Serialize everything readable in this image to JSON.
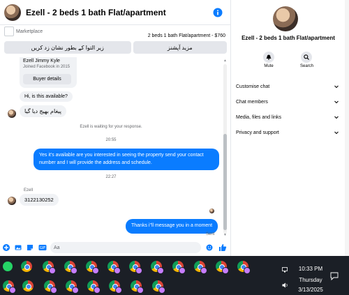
{
  "chat": {
    "title": "Ezell - 2 beds 1 bath Flat/apartment",
    "marketplace_label": "Marketplace",
    "listing_line": "2 beds 1 bath Flat/apartment - $760",
    "btn_more_options": "مزید آپشنز",
    "btn_mark_pending": "زیر التوا کے بطور نشان زد کریں"
  },
  "profile_card": {
    "name": "Ezell Jimmy Kyle",
    "joined": "Joined Facebook in 2015",
    "buyer_details": "Buyer details"
  },
  "messages": {
    "m1": "Hi, is this available?",
    "m2": "پیغام بھیج دیا گیا",
    "waiting": "Ezell is waiting for your response.",
    "time1": "20:55",
    "reply1": "Yes it's available are you interested in seeing the property send your contact number and I will provide the address and schedule.",
    "time2": "22:27",
    "sender": "Ezell",
    "m3": "3122130252",
    "reply2": "Thanks i\"ll message you in a moment",
    "sent": "Sent"
  },
  "composer": {
    "placeholder": "Aa"
  },
  "info": {
    "title": "Ezell - 2 beds 1 bath Flat/apartment",
    "mute": "Mute",
    "search": "Search",
    "menu": [
      {
        "label": "Customise chat"
      },
      {
        "label": "Chat members"
      },
      {
        "label": "Media, files and links"
      },
      {
        "label": "Privacy and support"
      }
    ]
  },
  "taskbar": {
    "time": "10:33 PM",
    "day": "Thursday",
    "date": "3/13/2025"
  },
  "colors": {
    "accent": "#0a7cff",
    "taskbar": "#1b1f26"
  }
}
